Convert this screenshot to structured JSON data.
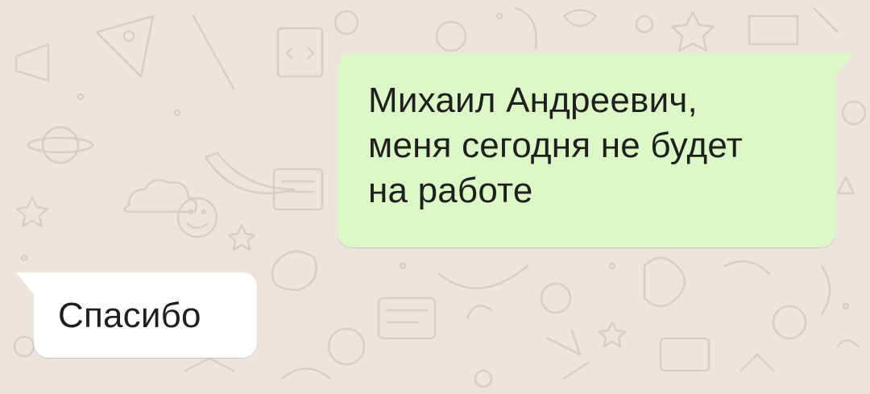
{
  "chat": {
    "background_color": "#ece5dd",
    "doodle_color": "#d6cfc6",
    "messages": [
      {
        "direction": "outgoing",
        "text": "Михаил Андреевич,\nменя сегодня не будет\nна работе",
        "bubble_color": "#dcf8c6"
      },
      {
        "direction": "incoming",
        "text": "Спасибо",
        "bubble_color": "#ffffff"
      }
    ]
  }
}
